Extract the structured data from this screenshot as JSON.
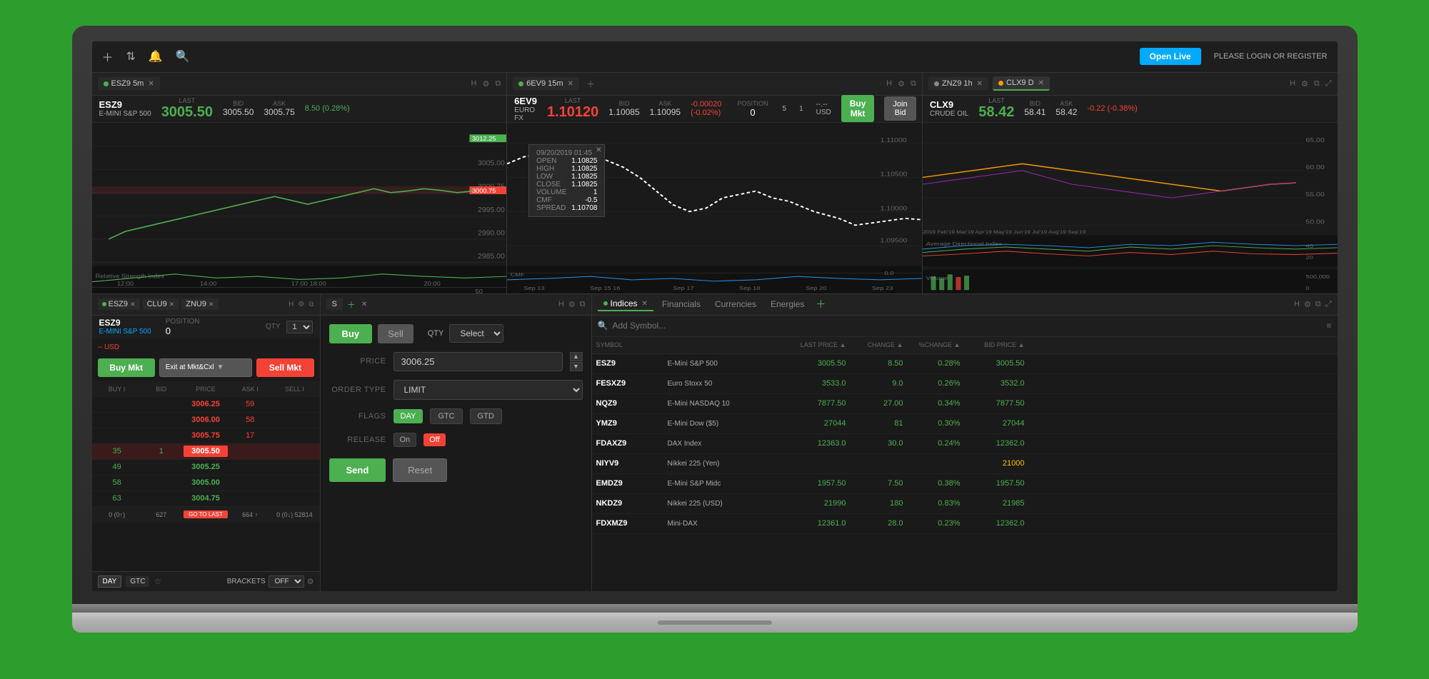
{
  "topbar": {
    "open_live": "Open Live",
    "login_text": "PLEASE LOGIN OR REGISTER"
  },
  "charts": [
    {
      "tab_symbol": "ESZ9",
      "tab_timeframe": "5m",
      "symbol": "ESZ9",
      "symbol_name": "E-MINI S&P 500",
      "last_label": "LAST",
      "bid_label": "BID",
      "ask_label": "ASK",
      "last_price": "3005.50",
      "bid_price": "3005.50",
      "ask_price": "3005.75",
      "change": "8.50 (0.28%)",
      "dot_color": "green"
    },
    {
      "tab_symbol": "6EV9",
      "tab_timeframe": "15m",
      "symbol": "6EV9",
      "symbol_name": "EURO FX",
      "last_label": "LAST",
      "bid_label": "BID",
      "ask_label": "ASK",
      "last_price": "1.10120",
      "bid_price": "1.10085",
      "ask_price": "1.10095",
      "change": "-0.00020 (-0.02%)",
      "position_label": "POSITION",
      "position_val": "0",
      "position_unit": "5",
      "position_unit2": "1",
      "position_usd": "--.-- USD",
      "dot_color": "green"
    },
    {
      "tab_symbol": "ZNZ9",
      "tab_timeframe": "1h",
      "extra_tab": "CLX9 D",
      "symbol": "CLX9",
      "symbol_name": "CRUDE OIL",
      "last_label": "LAST",
      "bid_label": "BID",
      "ask_label": "ASK",
      "last_price": "58.42",
      "bid_price": "58.41",
      "ask_price": "58.42",
      "change": "-0.22 (-0.38%)",
      "dot_color": "orange"
    }
  ],
  "order_panel": {
    "tab1": "ESZ9",
    "tab2": "CLU9",
    "tab3": "ZNU9",
    "symbol": "ESZ9",
    "symbol_name": "E-MINI S&P 500",
    "position_label": "POSITION",
    "position_val": "0",
    "qty_label": "QTY",
    "qty_val": "1",
    "usd_label": "-- USD",
    "btn_buy_mkt": "Buy Mkt",
    "btn_exit": "Exit at Mkt&Cxl",
    "btn_sell_mkt": "Sell Mkt",
    "dom_headers": [
      "BUY I",
      "BID",
      "PRICE",
      "ASK I",
      "SELL I"
    ],
    "dom_rows": [
      {
        "buy": "",
        "bid": "",
        "price": "3006.25",
        "ask": "59",
        "sell": ""
      },
      {
        "buy": "",
        "bid": "",
        "price": "3006.00",
        "ask": "58",
        "sell": ""
      },
      {
        "buy": "",
        "bid": "",
        "price": "3005.75",
        "ask": "17",
        "sell": ""
      },
      {
        "buy": "35",
        "bid": "1",
        "price": "3005.50",
        "ask": "",
        "sell": "",
        "highlight": true
      },
      {
        "buy": "49",
        "bid": "",
        "price": "3005.25",
        "ask": "",
        "sell": ""
      },
      {
        "buy": "58",
        "bid": "",
        "price": "3005.00",
        "ask": "",
        "sell": ""
      },
      {
        "buy": "63",
        "bid": "",
        "price": "3004.75",
        "ask": "",
        "sell": ""
      }
    ],
    "footer": {
      "col1": "0 (0↑)",
      "col2": "627",
      "go_to_last": "GO TO LAST",
      "col4": "664 ↑",
      "col5": "0 (0↓)",
      "col6": "52814"
    },
    "day_tag": "DAY",
    "gtc_tag": "GTC",
    "brackets_label": "BRACKETS",
    "brackets_val": "OFF"
  },
  "order_ticket": {
    "tab_label": "S",
    "buy_label": "Buy",
    "sell_label": "Sell",
    "qty_label": "QTY",
    "qty_select": "Select",
    "price_label": "PRICE",
    "price_val": "3006.25",
    "order_type_label": "ORDER TYPE",
    "order_type_val": "LIMIT",
    "flags_label": "FLAGS",
    "flag_day": "DAY",
    "flag_gtc": "GTC",
    "flag_gtd": "GTD",
    "release_label": "RELEASE",
    "release_on": "On",
    "release_off": "Off",
    "send_label": "Send",
    "reset_label": "Reset"
  },
  "tooltip": {
    "datetime": "09/20/2019 01:45",
    "open_label": "OPEN",
    "open_val": "1.10825",
    "high_label": "HIGH",
    "high_val": "1.10825",
    "low_label": "LOW",
    "low_val": "1.10825",
    "close_label": "CLOSE",
    "close_val": "1.10825",
    "volume_label": "VOLUME",
    "volume_val": "1",
    "cmf_label": "CMF",
    "cmf_val": "-0.5",
    "spread_label": "SPREAD",
    "spread_val": "1.10708"
  },
  "watchlist": {
    "tab_indices": "Indices",
    "tab_financials": "Financials",
    "tab_currencies": "Currencies",
    "tab_energies": "Energies",
    "search_placeholder": "Add Symbol...",
    "headers": [
      "SYMBOL",
      "",
      "LAST PRICE ▲",
      "CHANGE ▲",
      "%CHANGE ▲",
      "BID PRICE ▲"
    ],
    "rows": [
      {
        "symbol": "ESZ9",
        "name": "E-Mini S&P 500",
        "last": "3005.50",
        "change": "8.50",
        "pct": "0.28%",
        "bid": "3005.50",
        "color": "green"
      },
      {
        "symbol": "FESXZ9",
        "name": "Euro Stoxx 50",
        "last": "3533.0",
        "change": "9.0",
        "pct": "0.26%",
        "bid": "3532.0",
        "color": "green"
      },
      {
        "symbol": "NQZ9",
        "name": "E-Mini NASDAQ 10",
        "last": "7877.50",
        "change": "27.00",
        "pct": "0.34%",
        "bid": "7877.50",
        "color": "green"
      },
      {
        "symbol": "YMZ9",
        "name": "E-Mini Dow ($5)",
        "last": "27044",
        "change": "81",
        "pct": "0.30%",
        "bid": "27044",
        "color": "green"
      },
      {
        "symbol": "FDAXZ9",
        "name": "DAX Index",
        "last": "12363.0",
        "change": "30.0",
        "pct": "0.24%",
        "bid": "12362.0",
        "color": "green"
      },
      {
        "symbol": "NIYV9",
        "name": "Nikkei 225 (Yen)",
        "last": "",
        "change": "",
        "pct": "",
        "bid": "21000",
        "color": "yellow"
      },
      {
        "symbol": "EMDZ9",
        "name": "E-Mini S&P Midc",
        "last": "1957.50",
        "change": "7.50",
        "pct": "0.38%",
        "bid": "1957.50",
        "color": "green"
      },
      {
        "symbol": "NKDZ9",
        "name": "Nikkei 225 (USD)",
        "last": "21990",
        "change": "180",
        "pct": "0.83%",
        "bid": "21985",
        "color": "green"
      },
      {
        "symbol": "FDXMZ9",
        "name": "Mini-DAX",
        "last": "12361.0",
        "change": "28.0",
        "pct": "0.23%",
        "bid": "12362.0",
        "color": "green"
      }
    ]
  }
}
